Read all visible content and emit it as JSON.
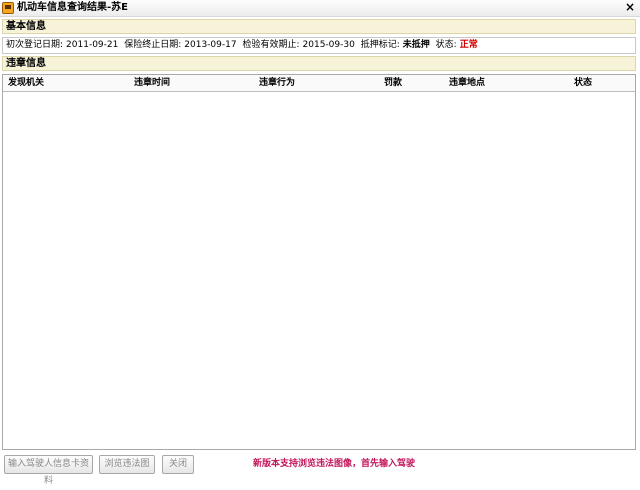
{
  "window": {
    "title": "机动车信息查询结果-苏E",
    "close_symbol": "×"
  },
  "basic_section": {
    "header": "基本信息",
    "fields": {
      "register_date_label": "初次登记日期:",
      "register_date": "2011-09-21",
      "insurance_end_label": "保险终止日期:",
      "insurance_end": "2013-09-17",
      "inspection_valid_label": "检验有效期止:",
      "inspection_valid": "2015-09-30",
      "mortgage_label": "抵押标记:",
      "mortgage": "未抵押",
      "status_label": "状态:",
      "status": "正常"
    }
  },
  "violation_section": {
    "header": "违章信息",
    "columns": [
      "发现机关",
      "违章时间",
      "违章行为",
      "罚款",
      "违章地点",
      "状态"
    ],
    "rows": []
  },
  "footer": {
    "btn_input_driver": "输入驾驶人信息卡资料",
    "btn_browse_images": "浏览违法图",
    "btn_close": "关闭",
    "notice": "新版本支持浏览违法图像，首先输入驾驶"
  },
  "colors": {
    "section_bg": "#f6f3d9",
    "status_ok": "#d40000",
    "notice": "#c2185b"
  }
}
